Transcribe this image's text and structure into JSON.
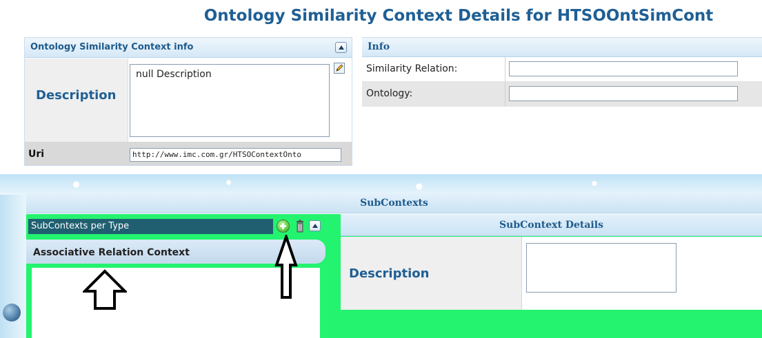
{
  "page": {
    "title": "Ontology Similarity Context Details for HTSOOntSimCont"
  },
  "context_info": {
    "title": "Ontology Similarity Context info",
    "description_label": "Description",
    "description_value": "null Description",
    "uri_label": "Uri",
    "uri_value": "http://www.imc.com.gr/HTSOContextOnto"
  },
  "info": {
    "title": "Info",
    "rows": [
      {
        "label": "Similarity Relation:",
        "value": ""
      },
      {
        "label": "Ontology:",
        "value": ""
      }
    ]
  },
  "subcontexts": {
    "title": "SubContexts",
    "type_select_value": "SubContexts per Type",
    "tab_label": "Associative Relation Context",
    "details": {
      "title": "SubContext Details",
      "description_label": "Description",
      "description_value": ""
    }
  },
  "icons": {
    "collapse": "chevron-up-icon",
    "edit": "pencil-edit-icon",
    "add": "plus-circle-icon",
    "delete": "trash-icon",
    "annotation_arrow": "up-arrow-icon"
  },
  "colors": {
    "title_blue": "#1f5f94",
    "panel_green": "#23f36f",
    "select_teal": "#1f5f70"
  }
}
